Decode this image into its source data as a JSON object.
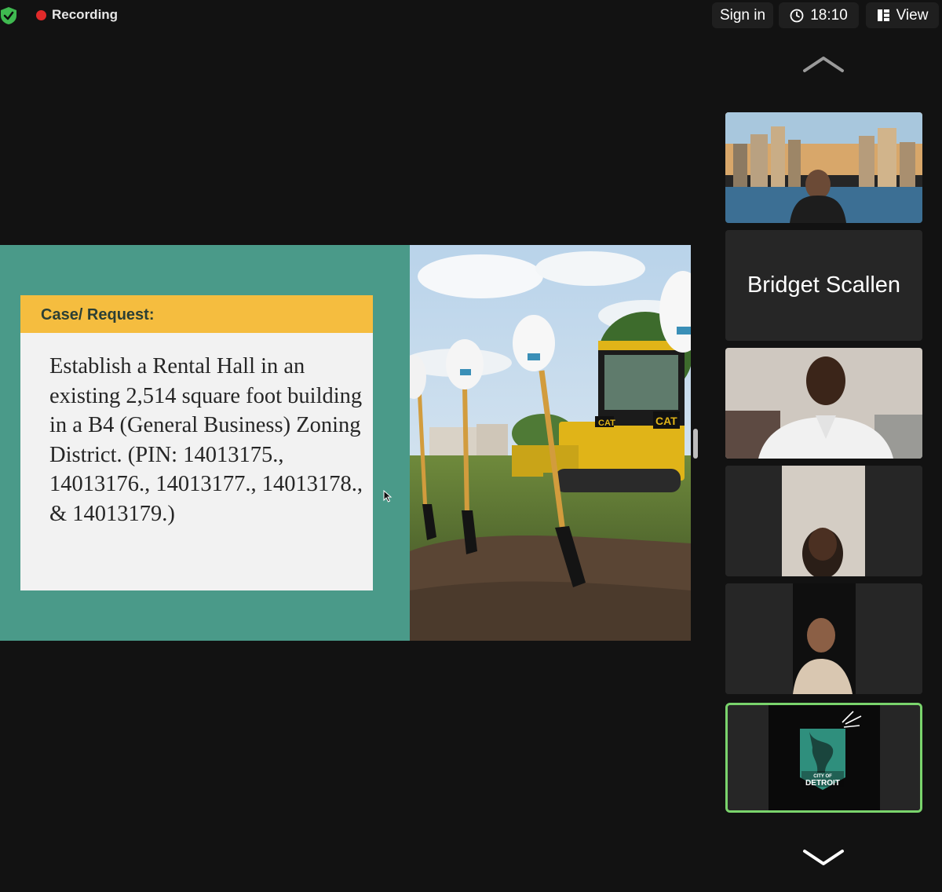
{
  "topbar": {
    "recording_label": "Recording",
    "sign_in_label": "Sign in",
    "time": "18:10",
    "view_label": "View"
  },
  "slide": {
    "case_title": "Case/ Request:",
    "case_body": "Establish a Rental Hall in an existing 2,514 square foot building in a B4 (General Business) Zoning District. (PIN: 14013175., 14013176., 14013177., 14013178., & 14013179.)",
    "photo_labels": [
      "CAT",
      "CAT"
    ]
  },
  "participants": [
    {
      "name": "",
      "type": "video"
    },
    {
      "name": "Bridget Scallen",
      "type": "name-only"
    },
    {
      "name": "",
      "type": "video"
    },
    {
      "name": "",
      "type": "video"
    },
    {
      "name": "",
      "type": "video"
    },
    {
      "name": "",
      "type": "video",
      "active_speaker": true,
      "logo_text_line1": "CITY OF",
      "logo_text_line2": "DETROIT"
    }
  ],
  "colors": {
    "background": "#121212",
    "tile": "#262626",
    "recording": "#e02a2a",
    "shield": "#3fb950",
    "slide_teal": "#4a9a89",
    "slide_gold": "#f5bd3f",
    "active_border": "#7ad46c"
  },
  "icons": [
    "shield-icon",
    "recording-dot-icon",
    "clock-icon",
    "view-icon",
    "chevron-up-icon",
    "chevron-down-icon",
    "cursor-icon"
  ]
}
